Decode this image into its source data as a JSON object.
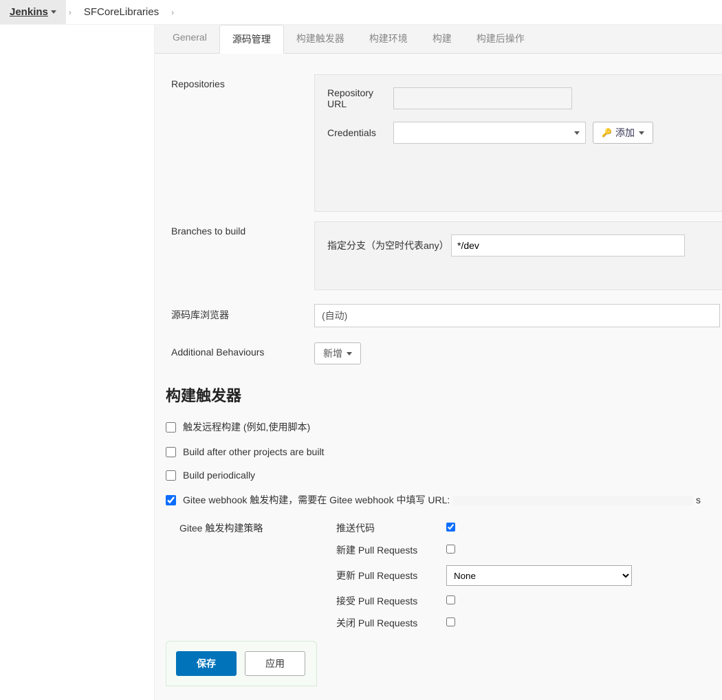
{
  "breadcrumb": {
    "root": "Jenkins",
    "project": "SFCoreLibraries"
  },
  "tabs": {
    "general": "General",
    "scm": "源码管理",
    "triggers": "构建触发器",
    "env": "构建环境",
    "build": "构建",
    "post": "构建后操作"
  },
  "scm": {
    "repositories_label": "Repositories",
    "repo_url_label": "Repository URL",
    "repo_url_value": "",
    "credentials_label": "Credentials",
    "credentials_value": "",
    "add_button": "添加",
    "branches_label": "Branches to build",
    "branch_spec_label": "指定分支（为空时代表any）",
    "branch_spec_value": "*/dev",
    "repo_browser_label": "源码库浏览器",
    "repo_browser_value": "(自动)",
    "additional_label": "Additional Behaviours",
    "additional_button": "新增"
  },
  "triggers": {
    "heading": "构建触发器",
    "remote": "触发远程构建 (例如,使用脚本)",
    "build_after": "Build after other projects are built",
    "periodically": "Build periodically",
    "gitee_webhook": "Gitee webhook 触发构建，需要在 Gitee webhook 中填写 URL: ",
    "gitee_webhook_url_tail": "s",
    "strategy_label": "Gitee 触发构建策略",
    "push_code": "推送代码",
    "new_pr": "新建 Pull Requests",
    "update_pr": "更新 Pull Requests",
    "update_pr_value": "None",
    "accept_pr": "接受 Pull Requests",
    "close_pr": "关闭 Pull Requests"
  },
  "buttons": {
    "save": "保存",
    "apply": "应用"
  }
}
